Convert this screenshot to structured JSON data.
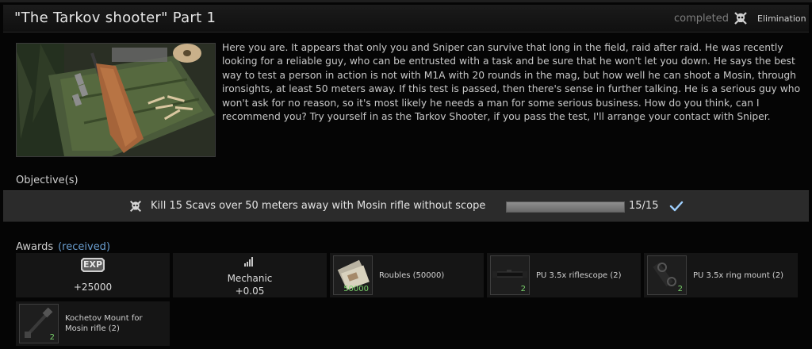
{
  "quest": {
    "title": "\"The Tarkov shooter\" Part 1",
    "status": "completed",
    "type_label": "Elimination",
    "type_icon": "skull-crossbones-icon"
  },
  "description": "Here you are. It appears that only you and Sniper can survive that long in the field, raid after raid. He was recently looking for a reliable guy, who can be entrusted with a task and be sure that he won't let you down. He says the best way to test a person in action is not with M1A with 20 rounds in the mag, but how well he can shoot a Mosin, through ironsights, at least 50 meters away. If this test is passed, then there's sense in further talking. He is a serious guy who won't ask for no reason, so it's most likely he needs a man for some serious business. How do you think, can I recommend you? Try yourself in as the Tarkov Shooter, if you pass the test, I'll arrange your contact with Sniper.",
  "objectives": {
    "heading": "Objective(s)",
    "items": [
      {
        "icon": "skull-crossbones-icon",
        "text": "Kill 15 Scavs over 50 meters away with Mosin rifle without scope",
        "progress_fraction": 1.0,
        "count": "15/15",
        "done": true
      }
    ]
  },
  "awards": {
    "heading": "Awards",
    "received_label": "(received)",
    "exp": {
      "badge": "EXP",
      "value": "+25000"
    },
    "reputation": {
      "trader": "Mechanic",
      "value": "+0.05",
      "icon": "reputation-bars-icon"
    },
    "items": [
      {
        "name": "Roubles (50000)",
        "qty": "50000",
        "icon": "roubles-bundle-icon"
      },
      {
        "name": "PU 3.5x riflescope (2)",
        "qty": "2",
        "icon": "riflescope-icon"
      },
      {
        "name": "PU 3.5x ring mount (2)",
        "qty": "2",
        "icon": "ring-mount-icon"
      },
      {
        "name": "Kochetov Mount for Mosin rifle (2)",
        "qty": "2",
        "icon": "kochetov-mount-icon"
      }
    ]
  },
  "colors": {
    "accent_blue": "#6a9ed0",
    "qty_green": "#7bd46c",
    "check_blue": "#9fd0ff"
  }
}
